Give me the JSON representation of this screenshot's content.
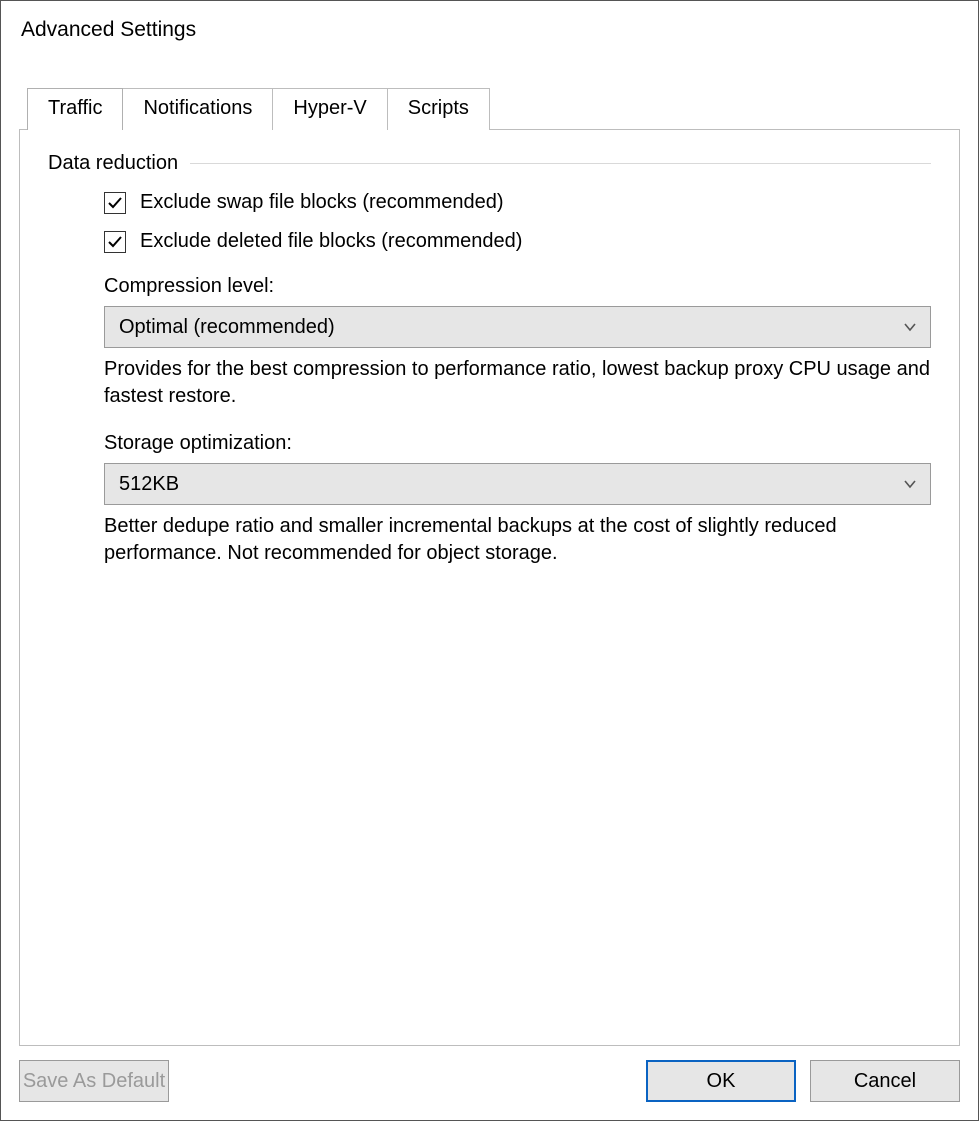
{
  "window": {
    "title": "Advanced Settings"
  },
  "tabs": [
    {
      "label": "Traffic",
      "active": true
    },
    {
      "label": "Notifications",
      "active": false
    },
    {
      "label": "Hyper-V",
      "active": false
    },
    {
      "label": "Scripts",
      "active": false
    }
  ],
  "traffic": {
    "group_label": "Data reduction",
    "exclude_swap": {
      "label": "Exclude swap file blocks (recommended)",
      "checked": true
    },
    "exclude_deleted": {
      "label": "Exclude deleted file blocks (recommended)",
      "checked": true
    },
    "compression": {
      "label": "Compression level:",
      "value": "Optimal (recommended)",
      "hint": "Provides for the best compression to performance ratio, lowest backup proxy CPU usage and fastest restore."
    },
    "storage_opt": {
      "label": "Storage optimization:",
      "value": "512KB",
      "hint": "Better dedupe ratio and smaller incremental backups at the cost of slightly reduced performance. Not recommended for object storage."
    }
  },
  "buttons": {
    "save_default": "Save As Default",
    "ok": "OK",
    "cancel": "Cancel"
  }
}
